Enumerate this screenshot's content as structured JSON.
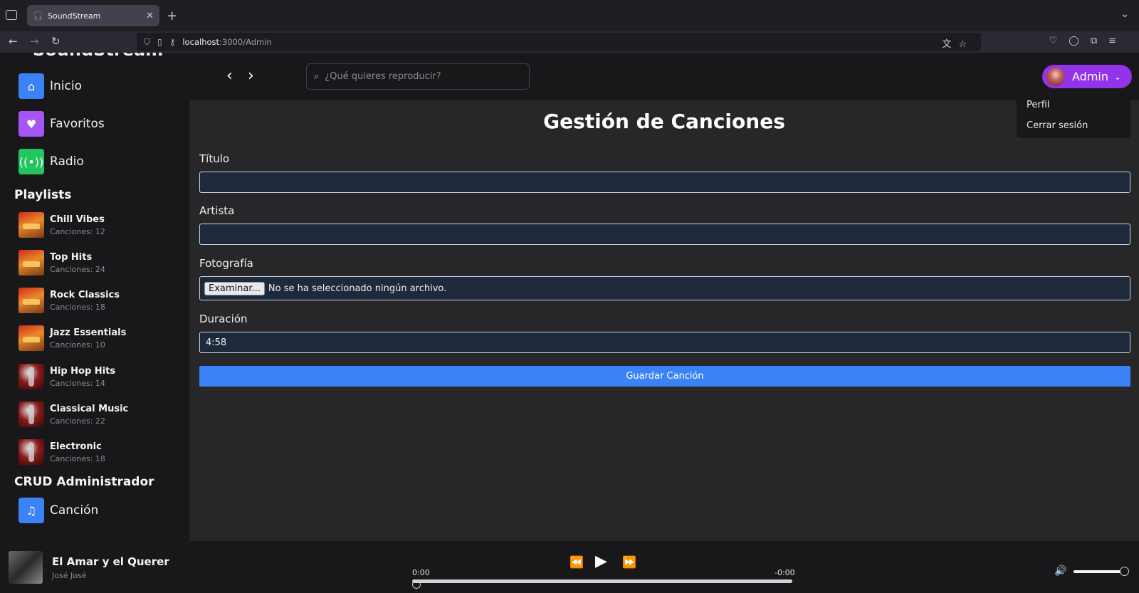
{
  "browser": {
    "tab_title": "SoundStream",
    "url_host": "localhost",
    "url_path": ":3000/Admin"
  },
  "app": {
    "logo_text": "SoundStream",
    "nav": [
      {
        "label": "Inicio",
        "icon": "home-icon",
        "color": "#3b82f6"
      },
      {
        "label": "Favoritos",
        "icon": "heart-icon",
        "color": "#a855f7"
      },
      {
        "label": "Radio",
        "icon": "radio-icon",
        "color": "#22c55e"
      }
    ],
    "playlists_title": "Playlists",
    "playlists": [
      {
        "name": "Chill Vibes",
        "count": "Canciones: 12"
      },
      {
        "name": "Top Hits",
        "count": "Canciones: 24"
      },
      {
        "name": "Rock Classics",
        "count": "Canciones: 18"
      },
      {
        "name": "Jazz Essentials",
        "count": "Canciones: 10"
      },
      {
        "name": "Hip Hop Hits",
        "count": "Canciones: 14"
      },
      {
        "name": "Classical Music",
        "count": "Canciones: 22"
      },
      {
        "name": "Electronic",
        "count": "Canciones: 18"
      }
    ],
    "crud_title": "CRUD Administrador",
    "crud_items": [
      {
        "label": "Canción",
        "icon": "music-note-icon",
        "color": "#3b82f6"
      }
    ]
  },
  "topbar": {
    "search_placeholder": "¿Qué quieres reproducir?",
    "user_name": "Admin",
    "user_menu": [
      "Perfil",
      "Cerrar sesión"
    ]
  },
  "form": {
    "title": "Gestión de Canciones",
    "fields": {
      "titulo_label": "Título",
      "titulo_value": "",
      "artista_label": "Artista",
      "artista_value": "",
      "foto_label": "Fotografía",
      "foto_button": "Examinar...",
      "foto_status": "No se ha seleccionado ningún archivo.",
      "duracion_label": "Duración",
      "duracion_value": "4:58"
    },
    "save_label": "Guardar Canción"
  },
  "player": {
    "song_title": "El Amar y el Querer",
    "artist": "José José",
    "elapsed": "0:00",
    "remaining": "-0:00",
    "progress_fraction": 0,
    "volume_fraction": 1
  }
}
